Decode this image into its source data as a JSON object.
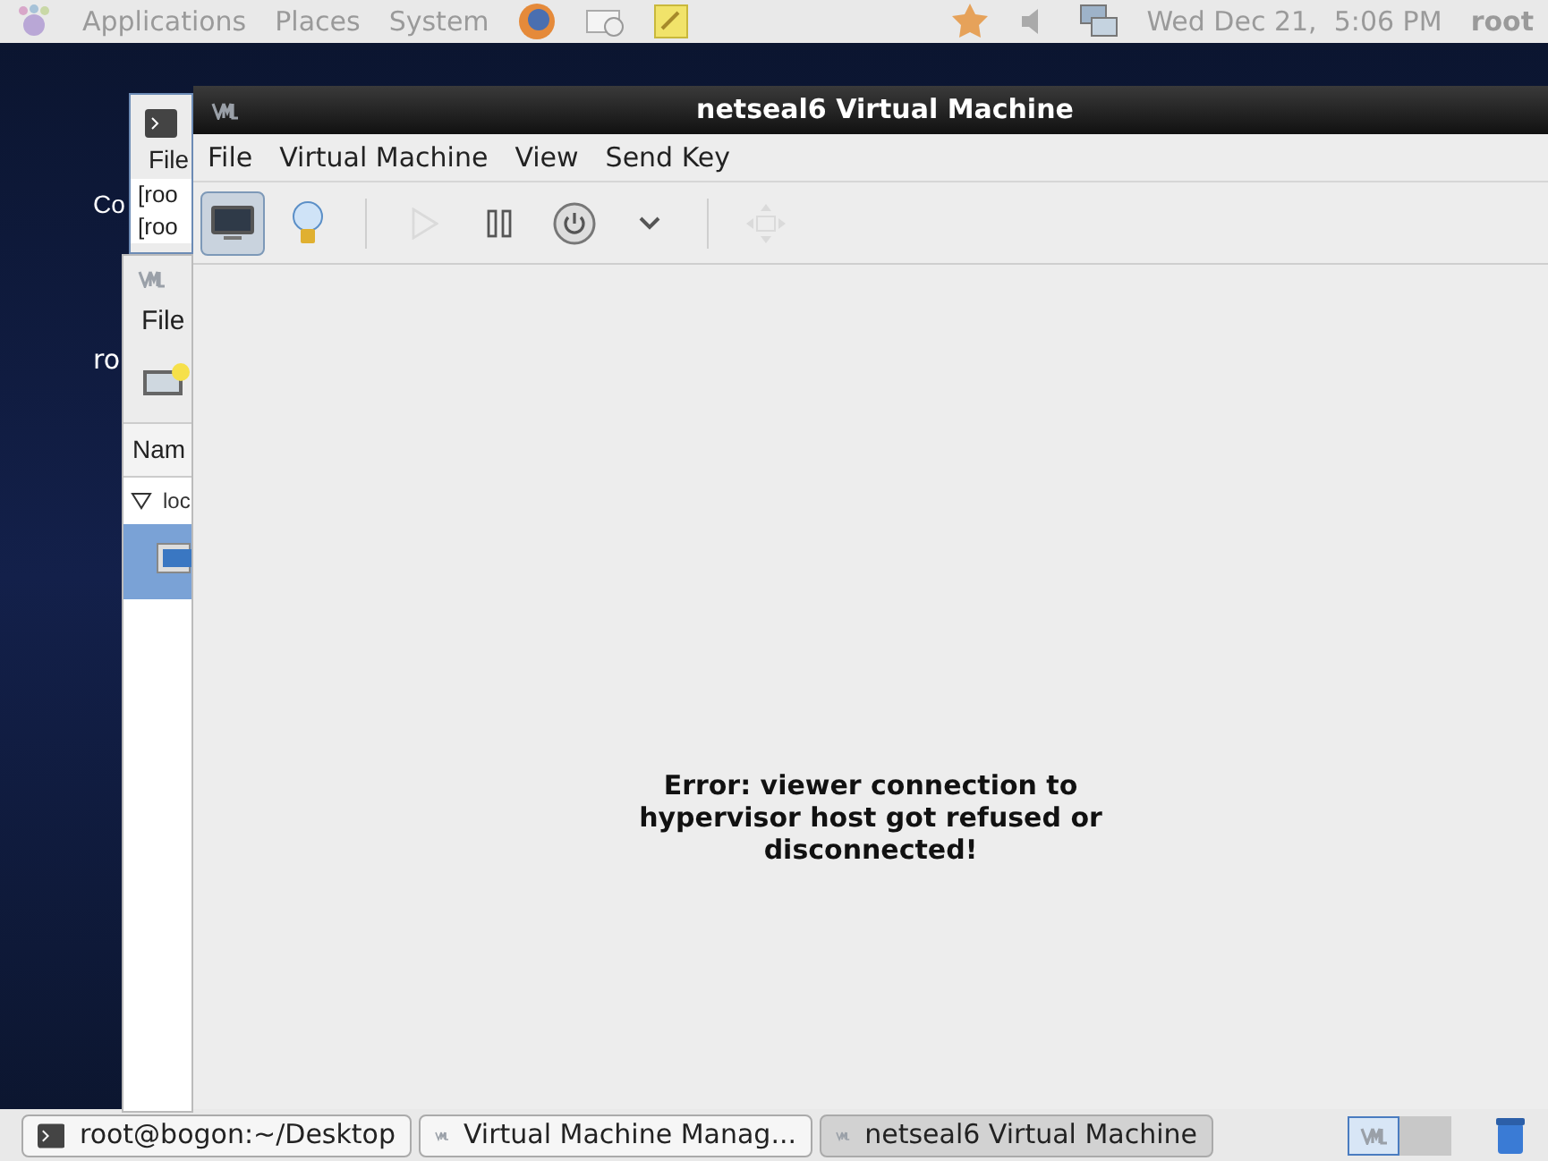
{
  "top_panel": {
    "menus": [
      "Applications",
      "Places",
      "System"
    ],
    "clock": "Wed Dec 21,  5:06 PM",
    "user": "root"
  },
  "desktop": {
    "icon_labels": [
      "Co",
      "ro"
    ]
  },
  "terminal_window": {
    "menu": "File",
    "lines": [
      "[roo",
      "[roo"
    ]
  },
  "manager_window": {
    "menu": "File",
    "column": "Nam",
    "tree_item": "loc",
    "expanded": true
  },
  "window": {
    "title": "netseal6 Virtual Machine",
    "menus": [
      "File",
      "Virtual Machine",
      "View",
      "Send Key"
    ],
    "toolbar": [
      {
        "kind": "console",
        "selected": true,
        "disabled": false
      },
      {
        "kind": "details",
        "selected": false,
        "disabled": false
      },
      {
        "kind": "separator"
      },
      {
        "kind": "run",
        "selected": false,
        "disabled": true
      },
      {
        "kind": "pause",
        "selected": false,
        "disabled": false
      },
      {
        "kind": "power",
        "selected": false,
        "disabled": false
      },
      {
        "kind": "dropdown",
        "selected": false,
        "disabled": false
      },
      {
        "kind": "separator"
      },
      {
        "kind": "fullscreen",
        "selected": false,
        "disabled": true
      }
    ],
    "error": "Error: viewer connection to hypervisor host got refused or disconnected!"
  },
  "taskbar": [
    {
      "kind": "terminal",
      "label": "root@bogon:~/Desktop",
      "selected": false
    },
    {
      "kind": "vm",
      "label": "Virtual Machine Manag...",
      "selected": false
    },
    {
      "kind": "vm",
      "label": "netseal6 Virtual Machine",
      "selected": true
    }
  ],
  "workspaces": [
    {
      "selected": true
    },
    {
      "selected": false
    }
  ]
}
